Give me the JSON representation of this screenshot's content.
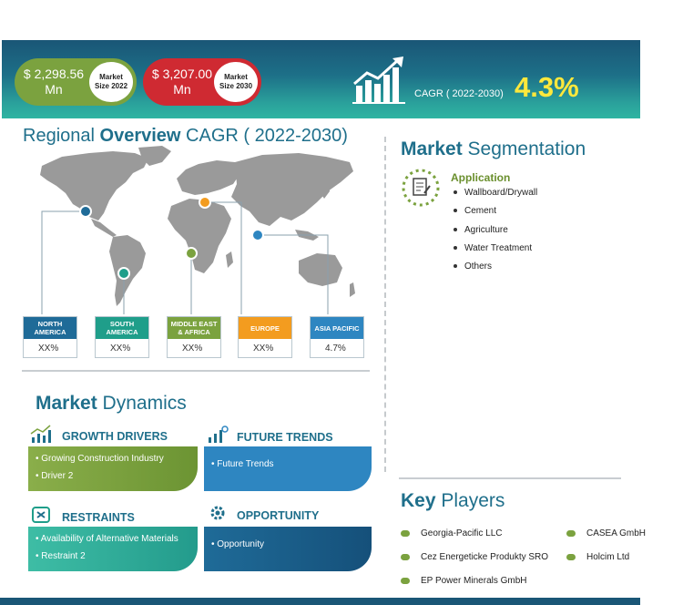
{
  "header": {
    "market_2022": {
      "value_line1": "$ 2,298.56",
      "value_line2": "Mn",
      "label_line1": "Market",
      "label_line2": "Size 2022"
    },
    "market_2030": {
      "value_line1": "$ 3,207.00",
      "value_line2": "Mn",
      "label_line1": "Market",
      "label_line2": "Size 2030"
    },
    "cagr_label": "CAGR ( 2022-2030)",
    "cagr_value": "4.3%"
  },
  "regional": {
    "title_part1": "Regional",
    "title_part2": "Overview",
    "title_part3": "CAGR ( 2022-2030)",
    "regions": [
      {
        "name_line1": "NORTH",
        "name_line2": "AMERICA",
        "value": "XX%",
        "color": "#1f6b98"
      },
      {
        "name_line1": "SOUTH",
        "name_line2": "AMERICA",
        "value": "XX%",
        "color": "#1f9e8a"
      },
      {
        "name_line1": "MIDDLE EAST",
        "name_line2": "& AFRICA",
        "value": "XX%",
        "color": "#7ba23f"
      },
      {
        "name_line1": "EUROPE",
        "name_line2": "",
        "value": "XX%",
        "color": "#f39c1f"
      },
      {
        "name_line1": "ASIA PACIFIC",
        "name_line2": "",
        "value": "4.7%",
        "color": "#2e86c1"
      }
    ]
  },
  "segmentation": {
    "title_part1": "Market",
    "title_part2": "Segmentation",
    "category": "Application",
    "items": [
      "Wallboard/Drywall",
      "Cement",
      "Agriculture",
      "Water Treatment",
      "Others"
    ]
  },
  "dynamics": {
    "title_part1": "Market",
    "title_part2": "Dynamics",
    "growth": {
      "heading": "GROWTH DRIVERS",
      "items": [
        "Growing Construction Industry",
        "Driver 2"
      ]
    },
    "future": {
      "heading": "FUTURE TRENDS",
      "items": [
        "Future Trends"
      ]
    },
    "restraints": {
      "heading": "RESTRAINTS",
      "items": [
        "Availability of Alternative Materials",
        "Restraint 2"
      ]
    },
    "opportunity": {
      "heading": "OPPORTUNITY",
      "items": [
        "Opportunity"
      ]
    }
  },
  "key_players": {
    "title_part1": "Key",
    "title_part2": "Players",
    "items": [
      "Georgia-Pacific LLC",
      "Cez Energeticke Produkty SRO",
      "EP Power Minerals GmbH",
      "CASEA GmbH",
      "Holcim Ltd"
    ]
  }
}
